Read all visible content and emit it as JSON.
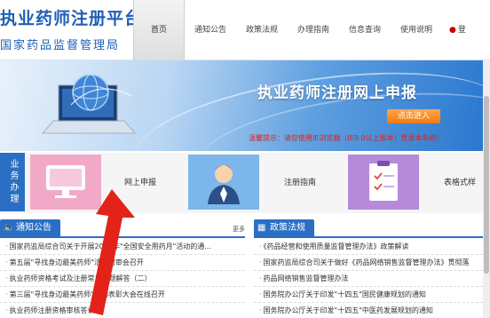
{
  "header": {
    "logo_title": "执业药师注册平台",
    "logo_subtitle": "国家药品监督管理局",
    "nav": [
      {
        "label": "首页",
        "active": true
      },
      {
        "label": "通知公告",
        "active": false
      },
      {
        "label": "政策法规",
        "active": false
      },
      {
        "label": "办理指南",
        "active": false
      },
      {
        "label": "信息查询",
        "active": false
      },
      {
        "label": "使用说明",
        "active": false
      },
      {
        "label": "登",
        "active": false
      }
    ]
  },
  "banner": {
    "title": "执业药师注册网上申报",
    "enter_button": "点击进入",
    "note": "温馨提示：请您使用IE浏览器（IE9.0以上版本）登录本系统！"
  },
  "services": {
    "side_label": "业务办理",
    "items": [
      {
        "label": "网上申报",
        "icon": "monitor-icon"
      },
      {
        "label": "注册指南",
        "icon": "user-icon"
      },
      {
        "label": "表格式样",
        "icon": "clipboard-icon"
      }
    ]
  },
  "notices": {
    "title": "通知公告",
    "more": "更多",
    "items": [
      "国家药监局综合司关于开展2023年\"全国安全用药月\"活动的通...",
      "第五届\"寻找身边最美药师\"活动初审会召开",
      "执业药师资格考试及注册常见问题解答（二）",
      "第三届\"寻找身边最美药师\"活动表彰大会在线召开",
      "执业药师注册资格审核答读"
    ]
  },
  "policies": {
    "title": "政策法规",
    "items": [
      "《药品经营和使用质量监督管理办法》政策解读",
      "国家药监局综合司关于做好《药品网络销售监督管理办法》贯彻落",
      "药品网络销售监督管理办法",
      "国务院办公厅关于印发\"十四五\"国民健康规划的通知",
      "国务院办公厅关于印发\"十四五\"中医药发展规划的通知"
    ]
  },
  "colors": {
    "brand_blue": "#2a6fc4",
    "logo_blue": "#1e5fb6",
    "alert_red": "#e0201a",
    "button_orange": "#f07a12"
  }
}
